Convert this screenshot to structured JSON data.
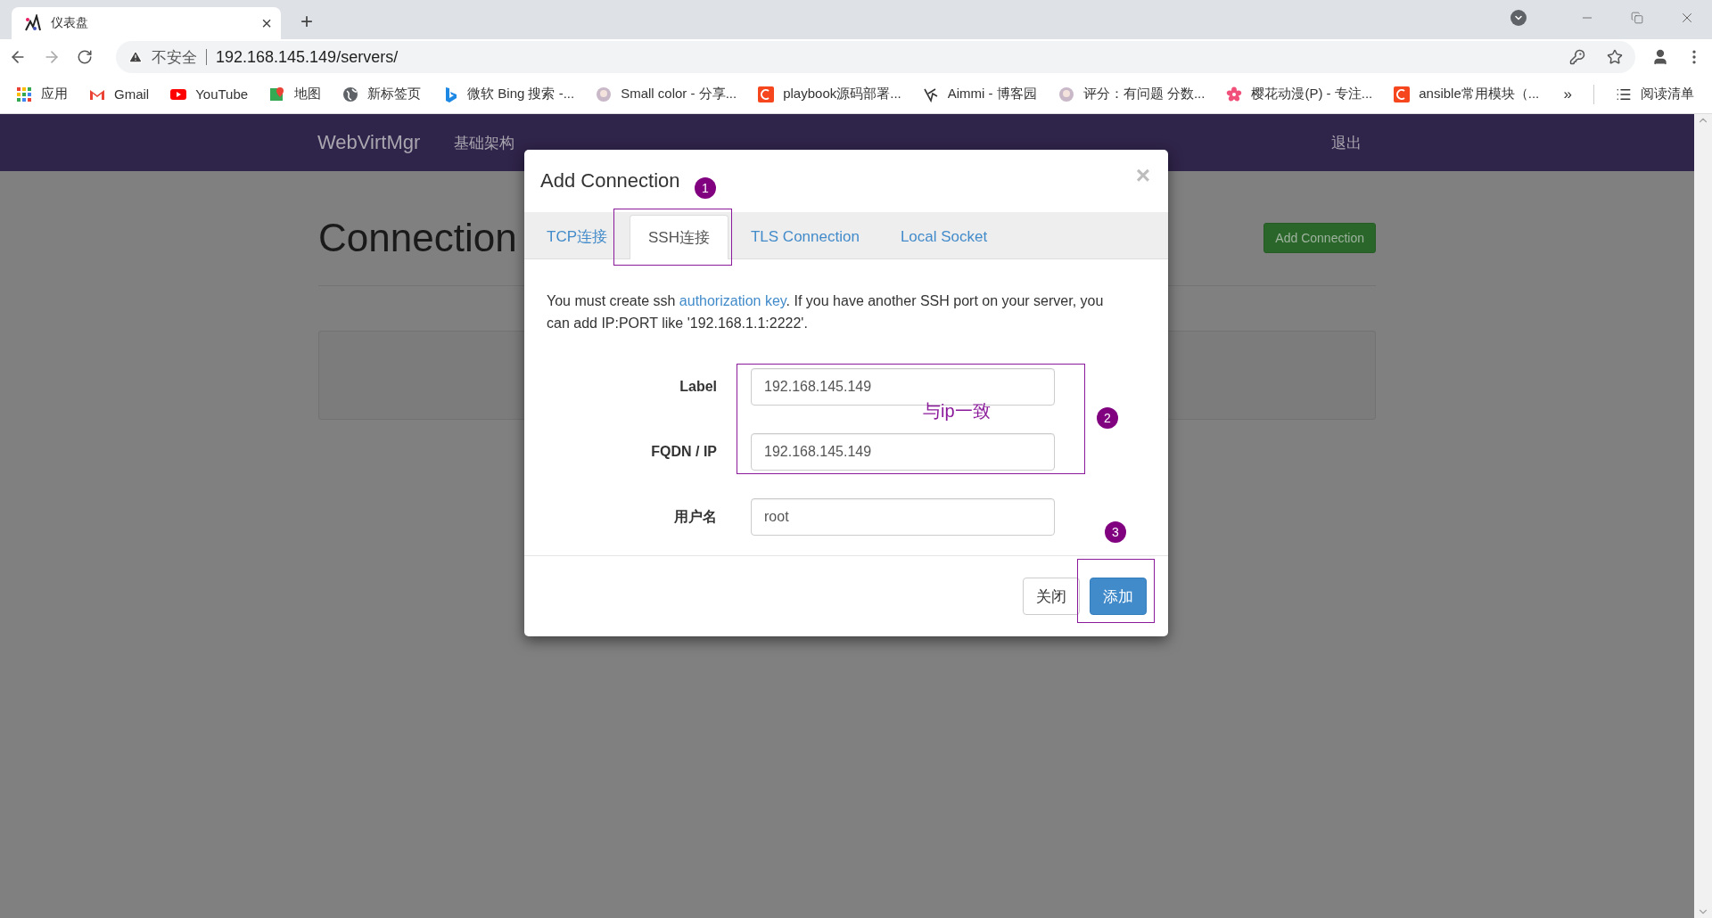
{
  "browser": {
    "tab": {
      "title": "仪表盘",
      "close": "×"
    },
    "new_tab": "+",
    "address": {
      "security": "不安全",
      "url": "192.168.145.149/servers/"
    },
    "bookmarks": [
      {
        "kind": "apps",
        "label": "应用"
      },
      {
        "kind": "mail",
        "label": "Gmail"
      },
      {
        "kind": "video",
        "label": "YouTube"
      },
      {
        "kind": "map",
        "label": "地图"
      },
      {
        "kind": "globe",
        "label": "新标签页"
      },
      {
        "kind": "bing",
        "label": "微软 Bing 搜索 -..."
      },
      {
        "kind": "avatar",
        "label": "Small color - 分享..."
      },
      {
        "kind": "badge",
        "label": "playbook源码部署..."
      },
      {
        "kind": "sketch",
        "label": "Aimmi - 博客园"
      },
      {
        "kind": "avatar",
        "label": "评分：有问题 分数..."
      },
      {
        "kind": "flower",
        "label": "樱花动漫(P) - 专注..."
      },
      {
        "kind": "badge",
        "label": "ansible常用模块（..."
      }
    ],
    "more": "»",
    "reading_list": "阅读清单"
  },
  "navbar": {
    "brand": "WebVirtMgr",
    "links": [
      "基础架构"
    ],
    "logout": "退出"
  },
  "page": {
    "heading": "Connection",
    "add_button": "Add Connection"
  },
  "modal": {
    "title": "Add Connection",
    "close": "×",
    "tabs": [
      {
        "label": "TCP连接",
        "selected": false
      },
      {
        "label": "SSH连接",
        "selected": true
      },
      {
        "label": "TLS Connection",
        "selected": false
      },
      {
        "label": "Local Socket",
        "selected": false
      }
    ],
    "notice": {
      "before": "You must create ssh ",
      "link": "authorization key",
      "after": ". If you have another SSH port on your server, you can add IP:PORT like '192.168.1.1:2222'."
    },
    "fields": [
      {
        "label": "Label",
        "value": "192.168.145.149"
      },
      {
        "label": "FQDN / IP",
        "value": "192.168.145.149"
      },
      {
        "label": "用户名",
        "value": "root"
      }
    ],
    "buttons": [
      {
        "kind": "default",
        "label": "关闭"
      },
      {
        "kind": "primary",
        "label": "添加"
      }
    ]
  },
  "annotations": {
    "markers": [
      "1",
      "2",
      "3"
    ],
    "note": "与ip一致"
  }
}
